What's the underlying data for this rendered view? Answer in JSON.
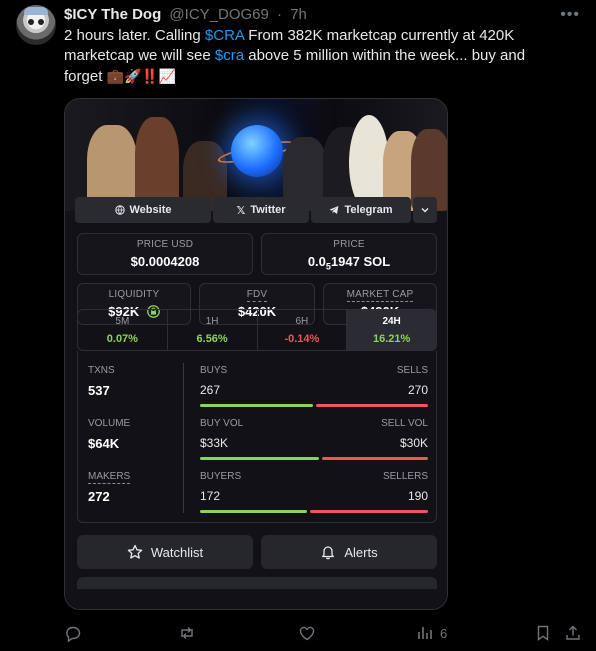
{
  "post": {
    "display_name": "$ICY The Dog",
    "handle": "@ICY_DOG69",
    "sep": "·",
    "time": "7h",
    "text_parts": [
      {
        "t": "2 hours later. Calling ",
        "cash": false
      },
      {
        "t": "$CRA",
        "cash": true
      },
      {
        "t": " From 382K marketcap currently at 420K marketcap we will see ",
        "cash": false
      },
      {
        "t": "$cra",
        "cash": true
      },
      {
        "t": " above 5 million within the week... buy and forget ",
        "cash": false
      }
    ],
    "emojis": "💼🚀‼️📈"
  },
  "card": {
    "links": {
      "website": "Website",
      "twitter": "Twitter",
      "telegram": "Telegram"
    },
    "price_usd": {
      "label": "PRICE USD",
      "value": "$0.0004208"
    },
    "price_sol": {
      "label": "PRICE",
      "value_pre": "0.0",
      "value_sub": "5",
      "value_post": "1947 SOL"
    },
    "liquidity": {
      "label": "LIQUIDITY",
      "value": "$92K"
    },
    "fdv": {
      "label": "FDV",
      "value": "$420K"
    },
    "market_cap": {
      "label": "MARKET CAP",
      "value": "$420K"
    },
    "tabs": [
      {
        "label": "5M",
        "value": "0.07%",
        "color": "#8bd35a"
      },
      {
        "label": "1H",
        "value": "6.56%",
        "color": "#8bd35a"
      },
      {
        "label": "6H",
        "value": "-0.14%",
        "color": "#f0545c"
      },
      {
        "label": "24H",
        "value": "16.21%",
        "color": "#8bd35a"
      }
    ],
    "txns": {
      "label": "TXNS",
      "value": "537",
      "left_label": "BUYS",
      "left_value": "267",
      "right_label": "SELLS",
      "right_value": "270"
    },
    "volume": {
      "label": "VOLUME",
      "value": "$64K",
      "left_label": "BUY VOL",
      "left_value": "$33K",
      "right_label": "SELL VOL",
      "right_value": "$30K"
    },
    "makers": {
      "label": "MAKERS",
      "value": "272",
      "left_label": "BUYERS",
      "left_value": "172",
      "right_label": "SELLERS",
      "right_value": "190"
    },
    "watchlist": "Watchlist",
    "alerts": "Alerts"
  },
  "actions": {
    "views": "6"
  },
  "colors": {
    "link": "#1d9bf0",
    "green": "#8bd35a",
    "red": "#f0545c"
  }
}
